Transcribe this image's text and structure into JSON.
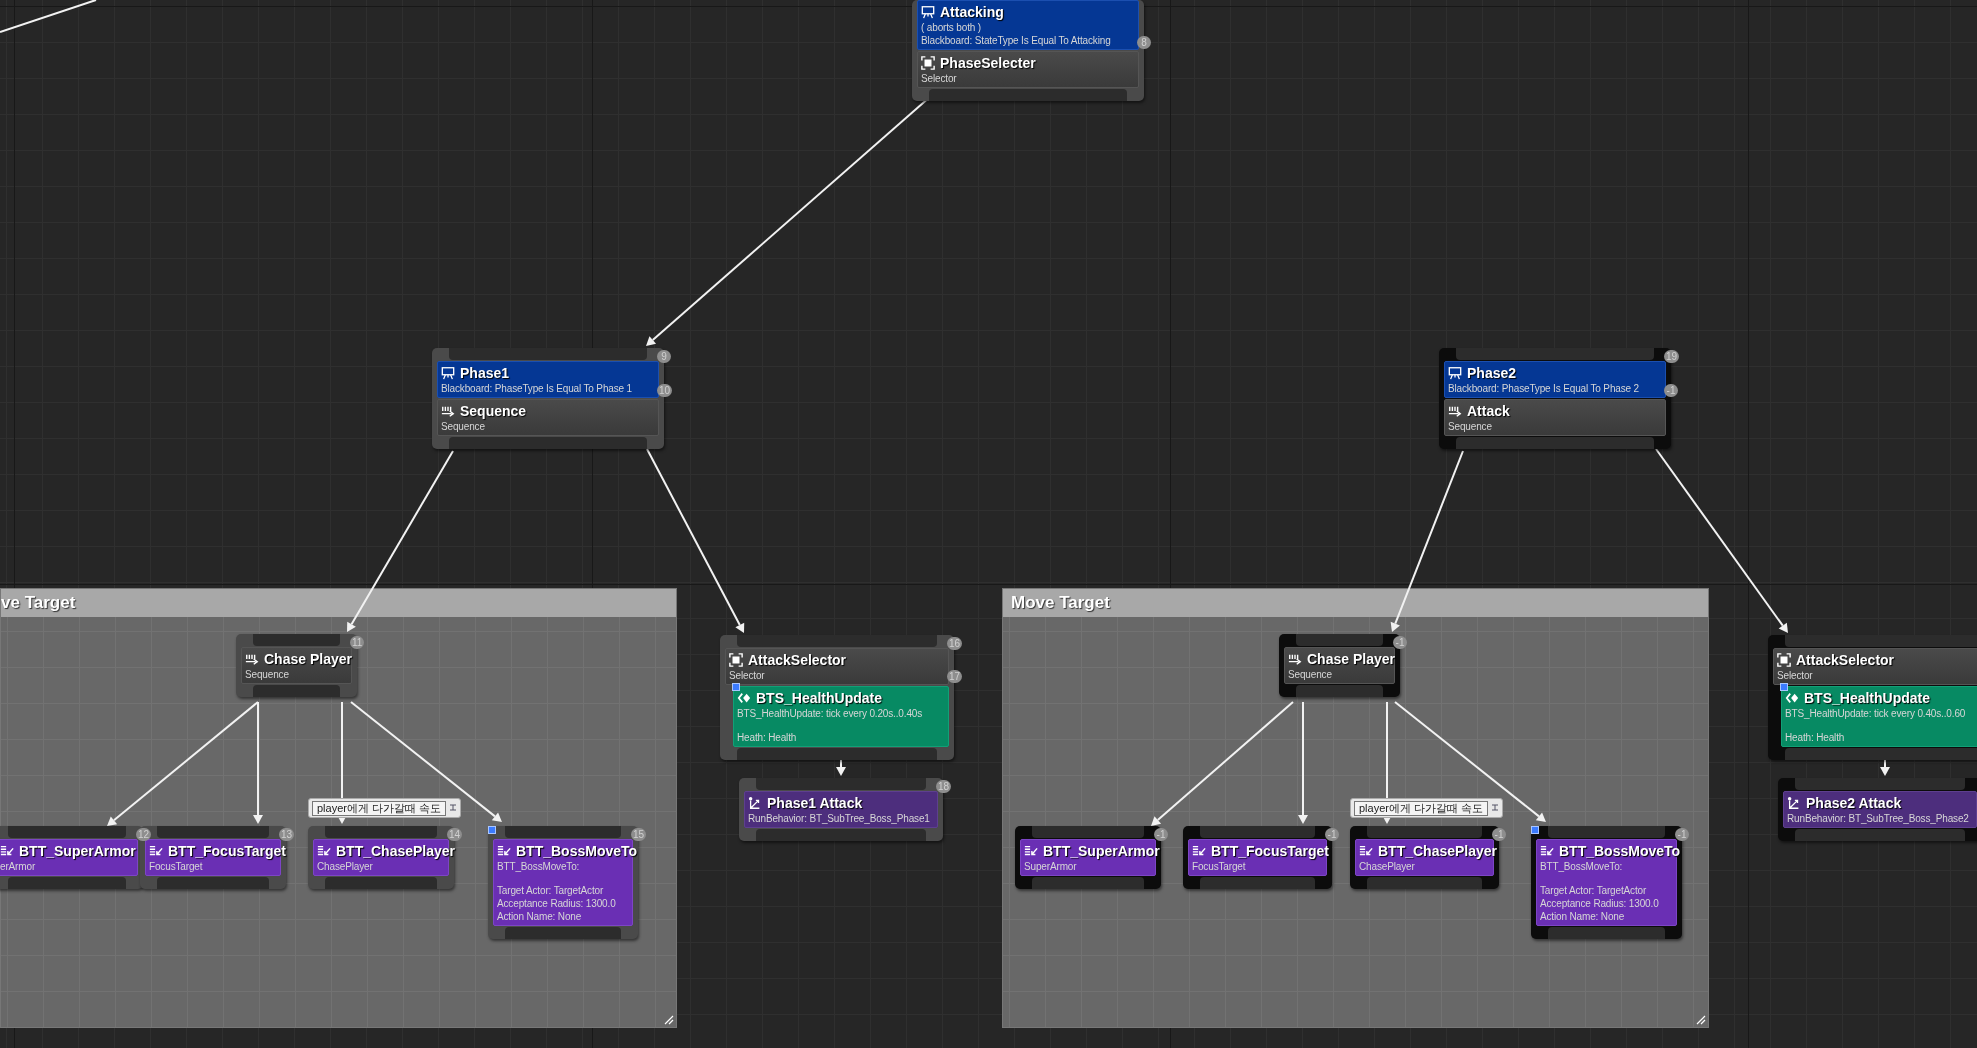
{
  "comments": [
    {
      "title": "ve Target"
    },
    {
      "title": "Move Target"
    }
  ],
  "nodes": [
    {
      "kind": "selector",
      "inactive": false,
      "title": "PhaseSelecter",
      "subtitle": "Selector",
      "decorators": [
        {
          "title": "Attacking",
          "lines": [
            "( aborts both )",
            "Blackboard: StateType Is Equal To Attacking"
          ],
          "badge": "8"
        }
      ]
    },
    {
      "kind": "sequence",
      "inactive": false,
      "title": "Sequence",
      "subtitle": "Sequence",
      "badge": "9",
      "decorators": [
        {
          "title": "Phase1",
          "lines": [
            "Blackboard: PhaseType Is Equal To Phase 1"
          ],
          "badge": "10"
        }
      ]
    },
    {
      "kind": "sequence",
      "inactive": false,
      "title": "Chase Player",
      "subtitle": "Sequence",
      "badge": "11"
    },
    {
      "kind": "task",
      "inactive": false,
      "title": "BTT_SuperArmor",
      "lines": [
        "erArmor"
      ],
      "badge": "12"
    },
    {
      "kind": "task",
      "inactive": false,
      "title": "BTT_FocusTarget",
      "lines": [
        "FocusTarget"
      ],
      "badge": "13"
    },
    {
      "kind": "task",
      "inactive": false,
      "title": "BTT_ChasePlayer",
      "lines": [
        "ChasePlayer"
      ],
      "badge": "14",
      "comment": "player에게 다가갈때 속도"
    },
    {
      "kind": "task",
      "inactive": false,
      "marked": true,
      "title": "BTT_BossMoveTo",
      "lines": [
        "BTT_BossMoveTo:"
      ],
      "details": [
        "Target Actor: TargetActor",
        "Acceptance Radius: 1300.0",
        "Action Name: None"
      ],
      "badge": "15"
    },
    {
      "kind": "selector",
      "inactive": false,
      "title": "AttackSelector",
      "subtitle": "Selector",
      "badge": "16",
      "services": [
        {
          "title": "BTS_HealthUpdate",
          "lines": [
            "BTS_HealthUpdate: tick every 0.20s..0.40s"
          ],
          "details": [
            "Heath: Health"
          ],
          "badge": "17",
          "marked": true
        }
      ]
    },
    {
      "kind": "subtree",
      "inactive": false,
      "title": "Phase1 Attack",
      "lines": [
        "RunBehavior: BT_SubTree_Boss_Phase1"
      ],
      "badge": "18"
    },
    {
      "kind": "sequence",
      "inactive": true,
      "title": "Attack",
      "subtitle": "Sequence",
      "badge": "19",
      "decorators": [
        {
          "title": "Phase2",
          "lines": [
            "Blackboard: PhaseType Is Equal To Phase 2"
          ],
          "badge": "-1"
        }
      ]
    },
    {
      "kind": "sequence",
      "inactive": true,
      "title": "Chase Player",
      "subtitle": "Sequence",
      "badge": "-1"
    },
    {
      "kind": "task",
      "inactive": true,
      "title": "BTT_SuperArmor",
      "lines": [
        "SuperArmor"
      ],
      "badge": "-1"
    },
    {
      "kind": "task",
      "inactive": true,
      "title": "BTT_FocusTarget",
      "lines": [
        "FocusTarget"
      ],
      "badge": "-1"
    },
    {
      "kind": "task",
      "inactive": true,
      "title": "BTT_ChasePlayer",
      "lines": [
        "ChasePlayer"
      ],
      "badge": "-1",
      "comment": "player에게 다가갈때 속도"
    },
    {
      "kind": "task",
      "inactive": true,
      "marked": true,
      "title": "BTT_BossMoveTo",
      "lines": [
        "BTT_BossMoveTo:"
      ],
      "details": [
        "Target Actor: TargetActor",
        "Acceptance Radius: 1300.0",
        "Action Name: None"
      ],
      "badge": "-1"
    },
    {
      "kind": "selector",
      "inactive": true,
      "title": "AttackSelector",
      "subtitle": "Selector",
      "services": [
        {
          "title": "BTS_HealthUpdate",
          "lines": [
            "BTS_HealthUpdate: tick every 0.40s..0.60"
          ],
          "details": [
            "Heath: Health"
          ],
          "marked": true
        }
      ]
    },
    {
      "kind": "subtree",
      "inactive": true,
      "title": "Phase2 Attack",
      "lines": [
        "RunBehavior: BT_SubTree_Boss_Phase2"
      ]
    }
  ]
}
